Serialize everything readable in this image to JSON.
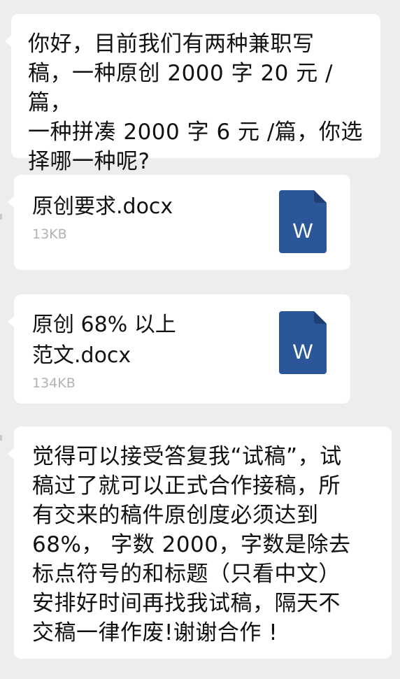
{
  "messages": {
    "msg1": {
      "text": "你好，目前我们有两种兼职写\n稿，一种原创 2000 字 20 元 /篇，\n一种拼凑 2000 字 6 元 /篇，你选\n择哪一种呢?"
    },
    "file1": {
      "name": "原创要求.docx",
      "size": "13KB",
      "icon": "word-document-icon",
      "icon_letter": "W",
      "icon_color": "#2b579a"
    },
    "file2": {
      "name": "原创 68% 以上\n范文.docx",
      "size": "134KB",
      "icon": "word-document-icon",
      "icon_letter": "W",
      "icon_color": "#2b579a"
    },
    "msg2": {
      "text": "觉得可以接受答复我“试稿”，试\n稿过了就可以正式合作接稿，所\n有交来的稿件原创度必须达到\n68%， 字数 2000，字数是除去\n标点符号的和标题（只看中文）\n安排好时间再找我试稿，隔天不\n交稿一律作废!谢谢合作 !"
    }
  },
  "colors": {
    "background": "#ededed",
    "bubble": "#ffffff",
    "text": "#111111",
    "meta": "#b2b2b2"
  }
}
